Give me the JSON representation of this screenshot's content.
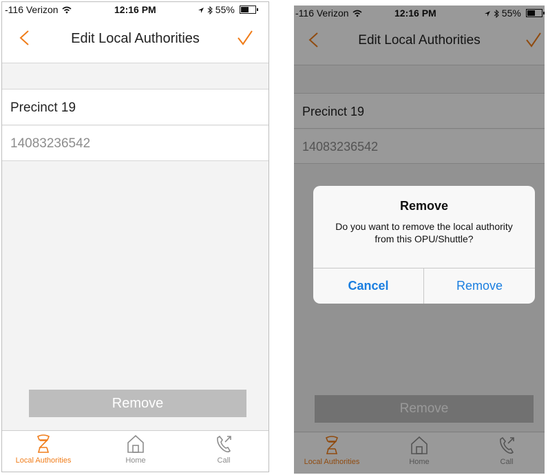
{
  "status_bar": {
    "carrier": "-116 Verizon",
    "time": "12:16 PM",
    "battery": "55%",
    "battery_level": 0.55
  },
  "nav": {
    "title": "Edit Local Authorities",
    "back_icon": "chevron-left-icon",
    "confirm_icon": "checkmark-icon"
  },
  "authority": {
    "name": "Precinct 19",
    "phone": "14083236542"
  },
  "remove_button": "Remove",
  "tabs": [
    {
      "label": "Local Authorities",
      "icon": "officer-icon",
      "active": true
    },
    {
      "label": "Home",
      "icon": "home-icon",
      "active": false
    },
    {
      "label": "Call",
      "icon": "phone-icon",
      "active": false
    }
  ],
  "dialog": {
    "title": "Remove",
    "message": "Do you want to remove the local authority from this OPU/Shuttle?",
    "cancel": "Cancel",
    "confirm": "Remove"
  },
  "colors": {
    "accent": "#f07d1a",
    "dialog_button": "#1a7ee0",
    "disabled_button": "#bdbdbd"
  }
}
